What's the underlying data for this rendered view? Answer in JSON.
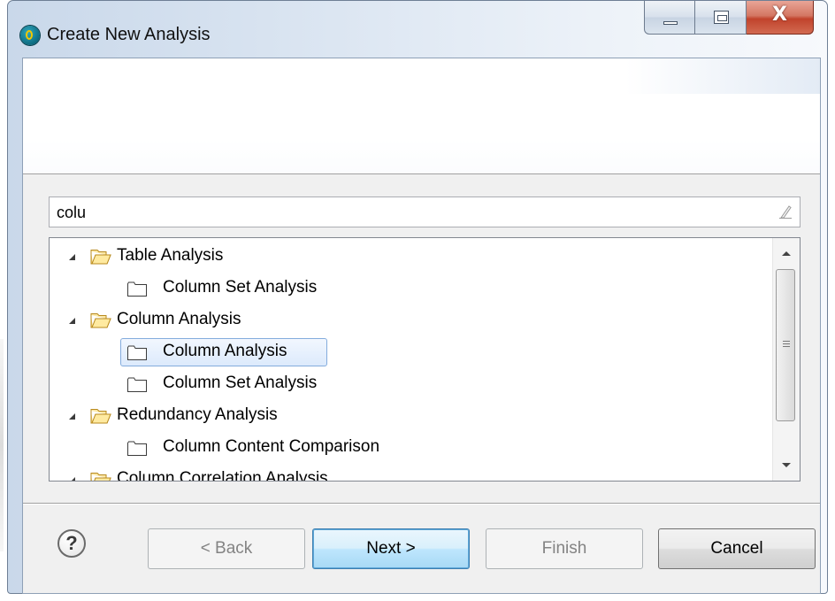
{
  "window": {
    "title": "Create New Analysis",
    "minimize_glyph": "",
    "close_glyph": "X"
  },
  "filter": {
    "value": "colu"
  },
  "tree": {
    "items": [
      {
        "label": "Table Analysis",
        "type": "folder",
        "expanded": true
      },
      {
        "label": "Column Set Analysis",
        "type": "item"
      },
      {
        "label": "Column Analysis",
        "type": "folder",
        "expanded": true
      },
      {
        "label": "Column Analysis",
        "type": "item",
        "selected": true
      },
      {
        "label": "Column Set Analysis",
        "type": "item"
      },
      {
        "label": "Redundancy Analysis",
        "type": "folder",
        "expanded": true
      },
      {
        "label": "Column Content Comparison",
        "type": "item"
      },
      {
        "label": "Column Correlation Analysis",
        "type": "folder",
        "expanded": true
      }
    ]
  },
  "buttons": {
    "help": "?",
    "back": "< Back",
    "next": "Next >",
    "finish": "Finish",
    "cancel": "Cancel"
  },
  "colors": {
    "accent": "#3c7fb1",
    "selection": "#84acdd",
    "close": "#c1432c"
  }
}
